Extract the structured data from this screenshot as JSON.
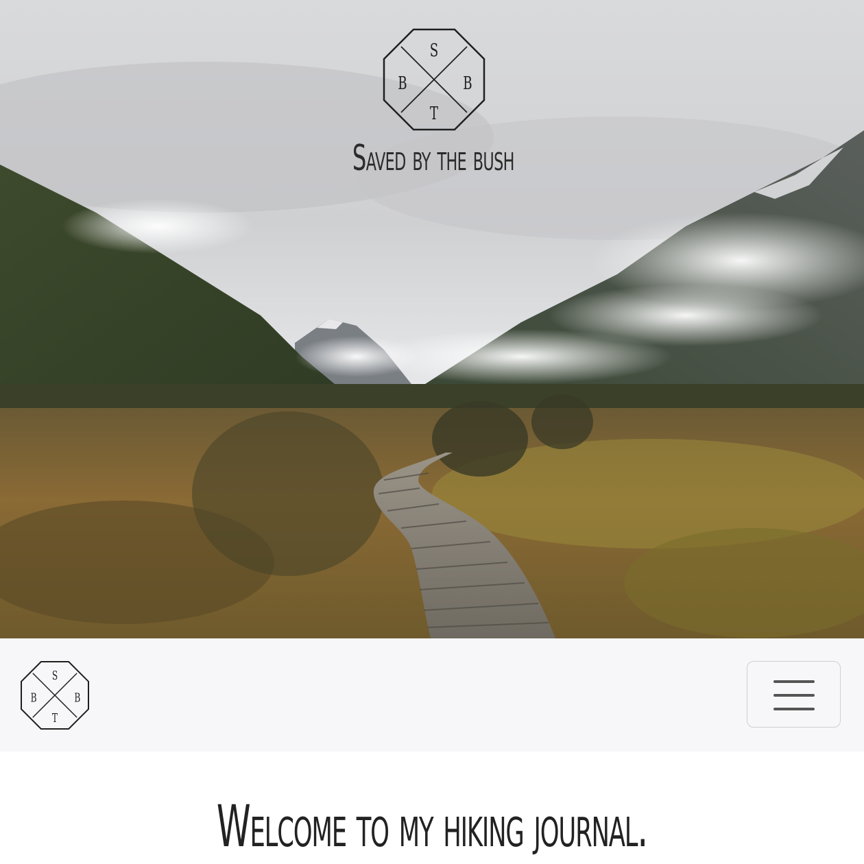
{
  "hero": {
    "image_description_icon": "mountain-valley-boardwalk-photo",
    "logo": {
      "letters": [
        "S",
        "B",
        "T",
        "B"
      ],
      "icon": "sbtb-octagon-logo"
    },
    "title": "Saved by the bush"
  },
  "navbar": {
    "brand_logo": {
      "letters": [
        "S",
        "B",
        "T",
        "B"
      ],
      "icon": "sbtb-octagon-logo"
    },
    "toggler_icon": "hamburger-menu-icon"
  },
  "main": {
    "heading": "Welcome to my hiking journal."
  },
  "colors": {
    "navbar_bg": "#f7f7f9",
    "text": "#222222",
    "toggler_border": "#cfcfd3"
  }
}
